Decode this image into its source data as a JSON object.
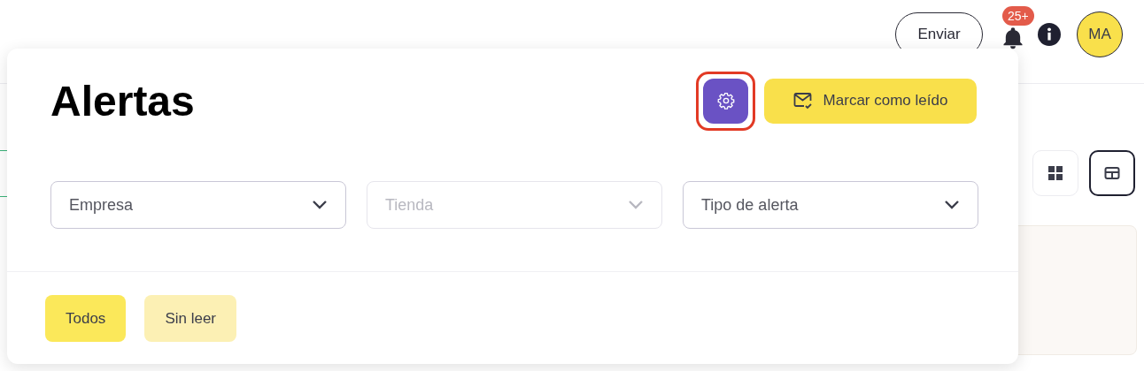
{
  "header": {
    "send_button": "Enviar",
    "notifications_badge": "25+",
    "avatar_initials": "MA"
  },
  "view_toggles": [
    {
      "kind": "grid",
      "selected": false
    },
    {
      "kind": "table",
      "selected": true
    }
  ],
  "alerts_panel": {
    "title": "Alertas",
    "settings_focused": true,
    "mark_read_button": "Marcar como leído",
    "filters": [
      {
        "placeholder": "Empresa",
        "disabled": false
      },
      {
        "placeholder": "Tienda",
        "disabled": true
      },
      {
        "placeholder": "Tipo de alerta",
        "disabled": false
      }
    ],
    "tabs": [
      {
        "label": "Todos",
        "selected": true
      },
      {
        "label": "Sin leer",
        "selected": false
      }
    ]
  }
}
